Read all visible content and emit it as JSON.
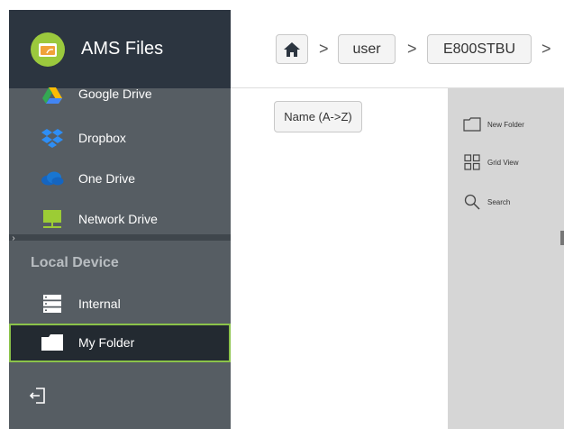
{
  "app": {
    "title": "AMS Files",
    "logo_icon": "ams-folder-logo-icon",
    "accent": "#8bc34a"
  },
  "sidebar": {
    "cloud_items": [
      {
        "label": "Google Drive",
        "icon": "google-drive-icon"
      },
      {
        "label": "Dropbox",
        "icon": "dropbox-icon"
      },
      {
        "label": "One Drive",
        "icon": "onedrive-icon"
      },
      {
        "label": "Network Drive",
        "icon": "network-drive-icon"
      }
    ],
    "local_section_title": "Local Device",
    "local_items": [
      {
        "label": "Internal",
        "icon": "storage-icon"
      },
      {
        "label": "My Folder",
        "icon": "folder-icon",
        "selected": true
      }
    ],
    "collapse_glyph": "›",
    "exit_icon": "exit-icon"
  },
  "breadcrumb": {
    "home_icon": "home-icon",
    "items": [
      "user",
      "E800STBU"
    ],
    "separator": ">"
  },
  "toolbar": {
    "sort_label": "Name (A->Z)"
  },
  "actions": [
    {
      "label": "New Folder",
      "icon": "new-folder-icon"
    },
    {
      "label": "Grid View",
      "icon": "grid-view-icon"
    },
    {
      "label": "Search",
      "icon": "search-icon"
    }
  ]
}
